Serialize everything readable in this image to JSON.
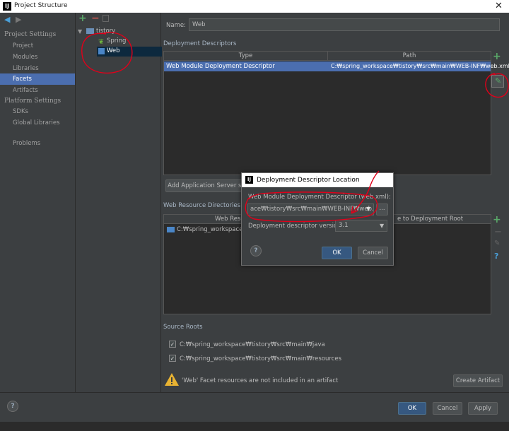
{
  "window": {
    "title": "Project Structure",
    "close": "✕"
  },
  "nav": {
    "project_settings": "Project Settings",
    "items1": [
      "Project",
      "Modules",
      "Libraries",
      "Facets",
      "Artifacts"
    ],
    "platform_settings": "Platform Settings",
    "items2": [
      "SDKs",
      "Global Libraries"
    ],
    "problems": "Problems",
    "selected": "Facets"
  },
  "tree": {
    "root": "tistory",
    "children": [
      "Spring",
      "Web"
    ],
    "selected": "Web"
  },
  "main": {
    "name_label": "Name:",
    "name_value": "Web",
    "deploy_section": "Deployment Descriptors",
    "deploy_headers": [
      "Type",
      "Path"
    ],
    "deploy_row": {
      "type": "Web Module Deployment Descriptor",
      "path": "C:₩spring_workspace₩tistory₩src₩main₩WEB-INF₩web.xml"
    },
    "add_server_btn": "Add Application Server sp",
    "web_res_section": "Web Resource Directories",
    "web_res_header_left": "Web Resou",
    "web_res_header_right": "e to Deployment Root",
    "web_res_row": "C:₩spring_workspace₩tis",
    "source_roots_section": "Source Roots",
    "source_roots": [
      "C:₩spring_workspace₩tistory₩src₩main₩java",
      "C:₩spring_workspace₩tistory₩src₩main₩resources"
    ],
    "warning": "'Web' Facet resources are not included in an artifact",
    "create_artifact_btn": "Create Artifact"
  },
  "dialog": {
    "title": "Deployment Descriptor Location",
    "descriptor_label": "Web Module Deployment Descriptor (web.xml):",
    "path_value": "ace₩tistory₩src₩main₩WEB-INF₩web.xml",
    "browse": "...",
    "version_label": "Deployment descriptor version",
    "version_value": "3.1",
    "ok": "OK",
    "cancel": "Cancel",
    "help": "?"
  },
  "footer": {
    "ok": "OK",
    "cancel": "Cancel",
    "apply": "Apply",
    "help": "?"
  },
  "colors": {
    "selection": "#4b6eaf",
    "annotation_red": "#e0001a",
    "add_green": "#59a869"
  }
}
